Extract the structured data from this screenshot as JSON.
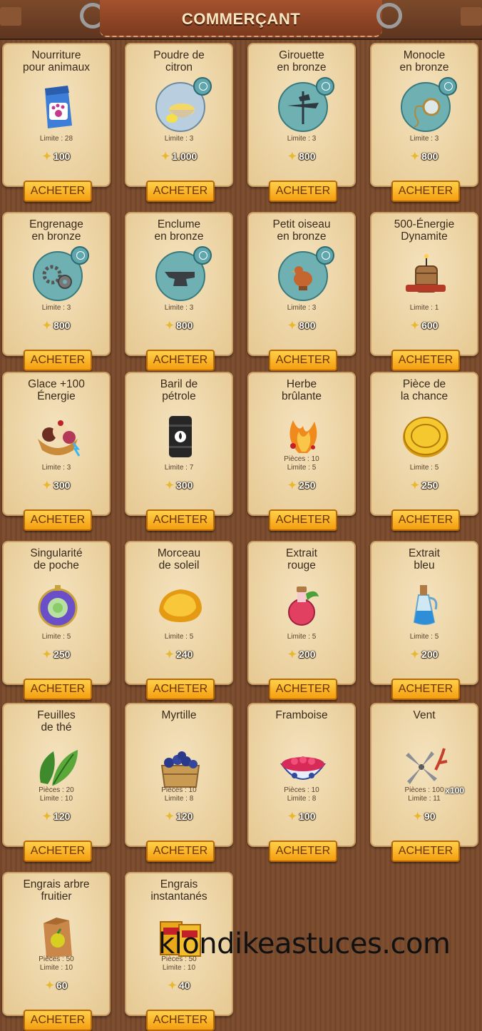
{
  "header": {
    "title": "COMMERÇANT"
  },
  "buy_label": "ACHETER",
  "watermark": "klondikeastuces.com",
  "items": [
    {
      "title": "Nourriture\npour animaux",
      "lines": [
        "Limite : 28"
      ],
      "price": "100",
      "icon": "pet-food-bag-icon"
    },
    {
      "title": "Poudre de\ncitron",
      "lines": [
        "Limite : 3"
      ],
      "price": "1.000",
      "icon": "lemon-powder-icon"
    },
    {
      "title": "Girouette\nen bronze",
      "lines": [
        "Limite : 3"
      ],
      "price": "800",
      "icon": "weathervane-icon"
    },
    {
      "title": "Monocle\nen bronze",
      "lines": [
        "Limite : 3"
      ],
      "price": "800",
      "icon": "monocle-icon"
    },
    {
      "title": "Engrenage\nen bronze",
      "lines": [
        "Limite : 3"
      ],
      "price": "800",
      "icon": "gear-icon"
    },
    {
      "title": "Enclume\nen bronze",
      "lines": [
        "Limite : 3"
      ],
      "price": "800",
      "icon": "anvil-icon"
    },
    {
      "title": "Petit oiseau\nen bronze",
      "lines": [
        "Limite : 3"
      ],
      "price": "800",
      "icon": "bird-icon"
    },
    {
      "title": "500-Énergie\nDynamite",
      "lines": [
        "Limite : 1"
      ],
      "price": "600",
      "icon": "dynamite-icon"
    },
    {
      "title": "Glace +100\nÉnergie",
      "lines": [
        "Limite : 3"
      ],
      "price": "300",
      "icon": "ice-cream-icon"
    },
    {
      "title": "Baril de\npétrole",
      "lines": [
        "Limite : 7"
      ],
      "price": "300",
      "icon": "oil-barrel-icon"
    },
    {
      "title": "Herbe\nbrûlante",
      "lines": [
        "Pièces : 10",
        "Limite : 5"
      ],
      "price": "250",
      "icon": "burning-herb-icon"
    },
    {
      "title": "Pièce de\nla chance",
      "lines": [
        "Limite : 5"
      ],
      "price": "250",
      "icon": "lucky-coin-icon"
    },
    {
      "title": "Singularité\nde poche",
      "lines": [
        "Limite : 5"
      ],
      "price": "250",
      "icon": "pocket-singularity-icon"
    },
    {
      "title": "Morceau\nde soleil",
      "lines": [
        "Limite : 5"
      ],
      "price": "240",
      "icon": "sun-piece-icon"
    },
    {
      "title": "Extrait\nrouge",
      "lines": [
        "Limite : 5"
      ],
      "price": "200",
      "icon": "red-extract-icon"
    },
    {
      "title": "Extrait\nbleu",
      "lines": [
        "Limite : 5"
      ],
      "price": "200",
      "icon": "blue-extract-icon"
    },
    {
      "title": "Feuilles\nde thé",
      "lines": [
        "Pièces : 20",
        "Limite : 10"
      ],
      "price": "120",
      "icon": "tea-leaves-icon"
    },
    {
      "title": "Myrtille",
      "lines": [
        "Pièces : 10",
        "Limite : 8"
      ],
      "price": "120",
      "icon": "blueberry-basket-icon"
    },
    {
      "title": "Framboise",
      "lines": [
        "Pièces : 10",
        "Limite : 8"
      ],
      "price": "100",
      "icon": "raspberry-bowl-icon"
    },
    {
      "title": "Vent",
      "lines": [
        "Pièces : 100",
        "Limite : 11"
      ],
      "price": "90",
      "icon": "windmill-icon",
      "badge": "x100"
    },
    {
      "title": "Engrais arbre\nfruitier",
      "lines": [
        "Pièces : 50",
        "Limite : 10"
      ],
      "price": "60",
      "icon": "fruit-fertilizer-icon"
    },
    {
      "title": "Engrais\ninstantanés",
      "lines": [
        "Pièces : 50",
        "Limite : 10"
      ],
      "price": "40",
      "icon": "instant-fertilizer-icon"
    }
  ]
}
